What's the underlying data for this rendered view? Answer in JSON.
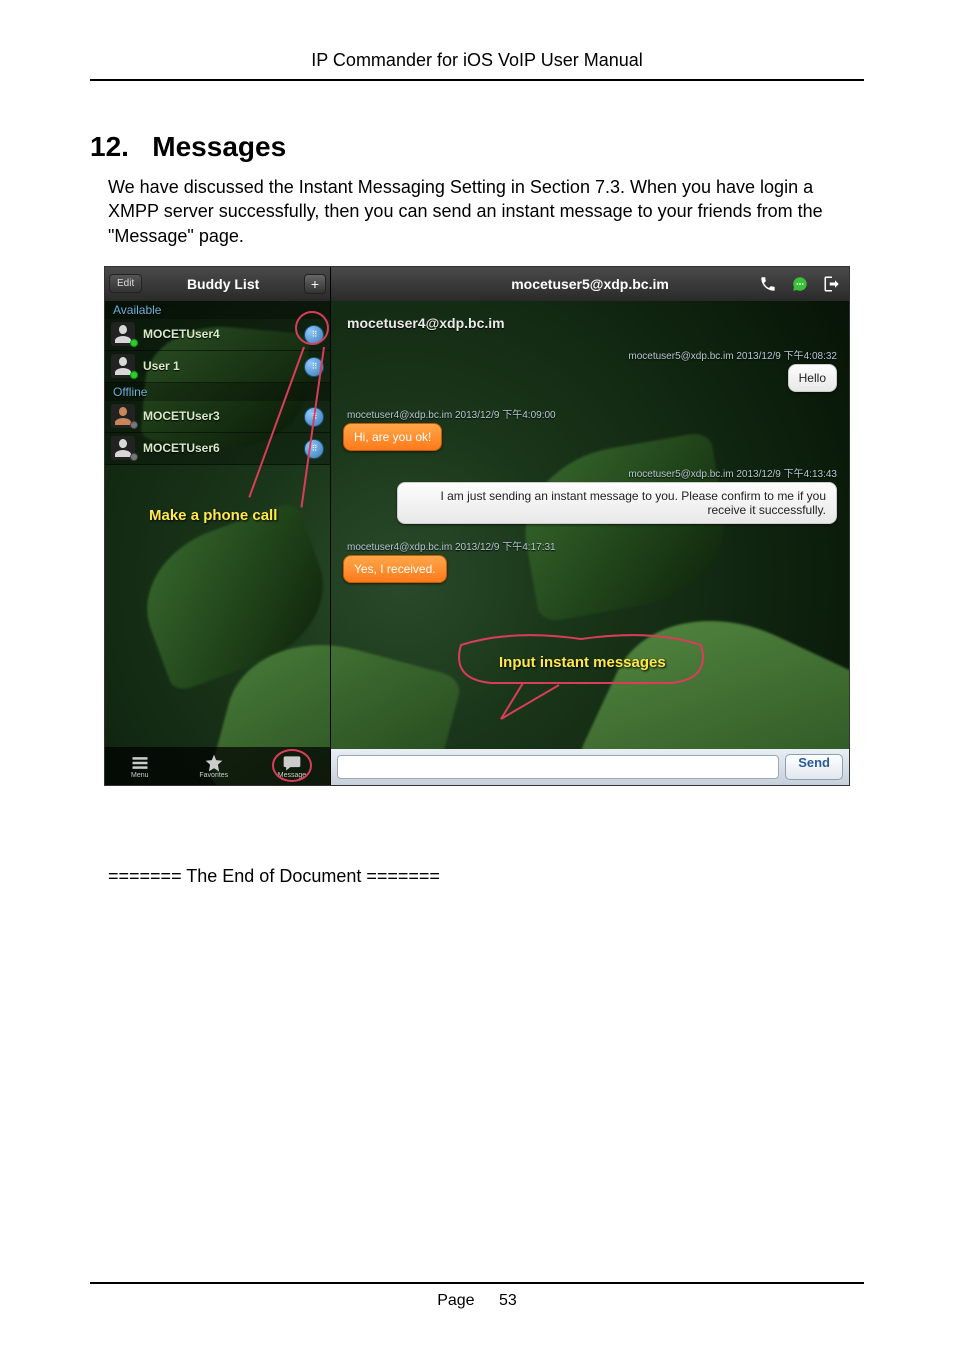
{
  "doc_header": "IP Commander for iOS VoIP User Manual",
  "section_number": "12.",
  "section_title": "Messages",
  "body_paragraph": "We have discussed the Instant Messaging Setting in Section 7.3.   When you have login a XMPP server successfully, then you can send an instant message to your friends from the \"Message\" page.",
  "end_doc": "======= The End of Document =======",
  "footer_page_label": "Page",
  "footer_page_number": "53",
  "buddy_list": {
    "edit_label": "Edit",
    "title": "Buddy List",
    "add_symbol": "+",
    "sections": {
      "available": "Available",
      "offline": "Offline"
    },
    "items": [
      {
        "name": "MOCETUser4",
        "status": "available"
      },
      {
        "name": "User 1",
        "status": "available"
      },
      {
        "name": "MOCETUser3",
        "status": "offline"
      },
      {
        "name": "MOCETUser6",
        "status": "offline"
      }
    ],
    "annotation": "Make a phone call",
    "tabs": {
      "menu": "Menu",
      "favorites": "Favorites",
      "message": "Message"
    }
  },
  "chat": {
    "title": "mocetuser5@xdp.bc.im",
    "contact_header": "mocetuser4@xdp.bc.im",
    "messages": [
      {
        "from": "out",
        "meta": "mocetuser5@xdp.bc.im 2013/12/9 下午4:08:32",
        "text": "Hello"
      },
      {
        "from": "in",
        "meta": "mocetuser4@xdp.bc.im 2013/12/9 下午4:09:00",
        "text": "Hi, are you ok!"
      },
      {
        "from": "out",
        "meta": "mocetuser5@xdp.bc.im 2013/12/9 下午4:13:43",
        "text": "I am just sending an instant message to you.  Please confirm to me if you receive it successfully."
      },
      {
        "from": "in",
        "meta": "mocetuser4@xdp.bc.im 2013/12/9 下午4:17:31",
        "text": "Yes, I received."
      }
    ],
    "input_annotation": "Input instant messages",
    "send_label": "Send"
  }
}
